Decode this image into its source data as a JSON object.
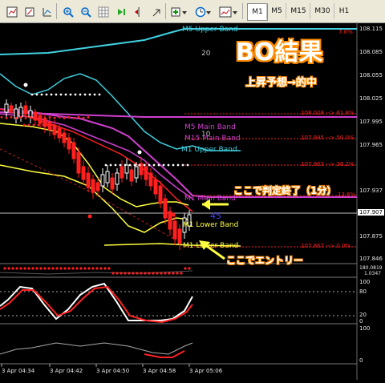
{
  "toolbar": {
    "icons": [
      "new-chart-icon",
      "zoom-in-icon",
      "zoom-out-icon",
      "grid-icon",
      "auto-scroll-icon",
      "chart-shift-icon",
      "indicators-icon",
      "clock-icon",
      "template-icon"
    ],
    "timeframes": [
      "M1",
      "M5",
      "M15",
      "M30",
      "H1"
    ],
    "active_timeframe": "M1"
  },
  "chart": {
    "title_overlay": "BO結果",
    "subtitle_overlay": "上昇予想→的中",
    "callout_judgement": "ここで判定終了（1分）",
    "callout_entry": "ここでエントリー",
    "top_right_marker": "7.0%",
    "number_45": "45",
    "number_20": "20",
    "number_10": "10",
    "band_labels": {
      "m5_upper": "M5 Upper Band",
      "m5_main": "M5 Main Band",
      "m15_main": "M15 Main Band",
      "m1_upper": "M1 Upper Band",
      "m1_main": "M1 Main Band",
      "m1_lower": "M1 Lower Band",
      "m1_lower2": "M1 Lower Band"
    },
    "fib_levels": [
      "108.028 --> 61.8%",
      "107.995 --> 50.0%",
      "107.963 --> 38.2%",
      "13.6%",
      "107.867 --> 0.0%"
    ],
    "current_price": "107.907",
    "price_axis": [
      "108.115",
      "108.085",
      "108.055",
      "108.025",
      "107.995",
      "107.965",
      "107.937",
      "107.907",
      "107.875",
      "107.846"
    ],
    "sub_axis": {
      "osc1": [
        "180.0819",
        "1.0347"
      ],
      "stoch": [
        "100",
        "80",
        "20",
        "0"
      ],
      "osc3": [
        "100",
        "0"
      ]
    },
    "time_axis": [
      "3 Apr 04:34",
      "3 Apr 04:42",
      "3 Apr 04:50",
      "3 Apr 04:58",
      "3 Apr 05:06"
    ],
    "colors": {
      "bull": "#ffffff",
      "bear": "#ff2020",
      "m5_band": "#40d0e0",
      "m1_band": "#ffff40",
      "main_band": "#d040d0",
      "fib": "#ff2020",
      "accent_orange": "#ff8c00"
    }
  }
}
